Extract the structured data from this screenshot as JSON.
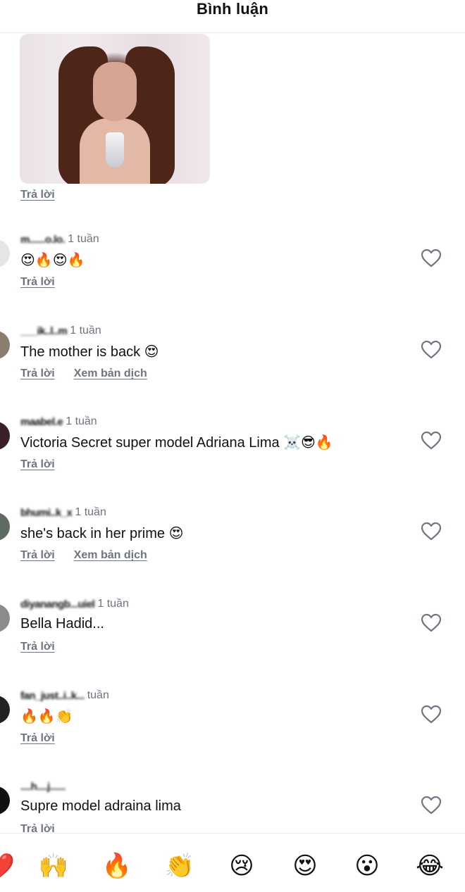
{
  "header": {
    "title": "Bình luận"
  },
  "top_reply_label": "Trả lời",
  "comments": [
    {
      "username": "m......o.lo.",
      "time": "1 tuần",
      "text": "😍🔥😍🔥",
      "reply": "Trả lời",
      "translate": "",
      "avatar_color": "#e6e6e6"
    },
    {
      "username": "___ik..l..m",
      "time": "1 tuần",
      "text": "The mother is back 😍",
      "reply": "Trả lời",
      "translate": "Xem bản dịch",
      "avatar_color": "#8a7f6e"
    },
    {
      "username": "maabel.e",
      "time": "1 tuần",
      "text": "Victoria Secret super model Adriana Lima ☠️😎🔥",
      "reply": "Trả lời",
      "translate": "",
      "avatar_color": "#3a1f2a"
    },
    {
      "username": "bhumi..k_x",
      "time": "1 tuần",
      "text": "she's back in her prime 😍",
      "reply": "Trả lời",
      "translate": "Xem bản dịch",
      "avatar_color": "#5d6b63"
    },
    {
      "username": "diyanangb...uiel",
      "time": "1 tuần",
      "text": "Bella Hadid...",
      "reply": "Trả lời",
      "translate": "",
      "avatar_color": "#8b8b8b"
    },
    {
      "username": "fan_just..i..k...",
      "time": "tuần",
      "text": "🔥🔥👏",
      "reply": "Trả lời",
      "translate": "",
      "avatar_color": "#222222"
    },
    {
      "username": "....h....j......",
      "time": "",
      "text": "Supre model adraina lima",
      "reply": "Trả lời",
      "translate": "",
      "avatar_color": "#111111"
    }
  ],
  "quick_emojis": [
    "❤️",
    "🙌",
    "🔥",
    "👏",
    "😢",
    "😍",
    "😮",
    "😂"
  ]
}
